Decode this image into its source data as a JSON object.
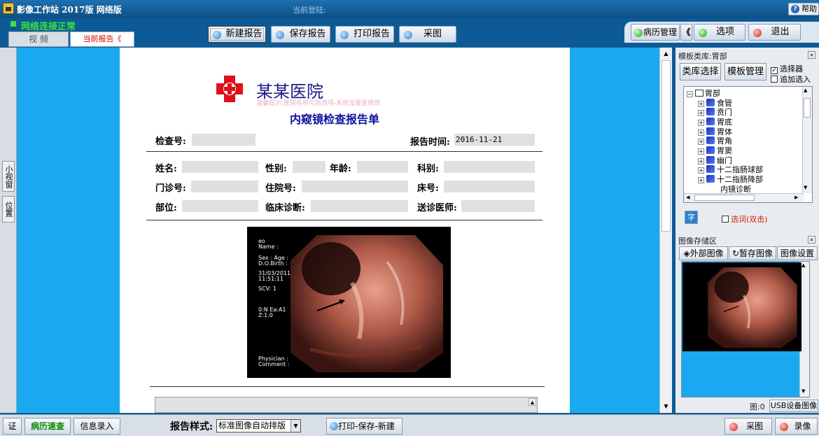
{
  "titlebar": {
    "app_title": "影像工作站 2017版 网络版",
    "login_label": "当前登陆:",
    "help": "帮助"
  },
  "status": {
    "network": "网络连接正常"
  },
  "tabs": {
    "video": "视 频",
    "current_report": "当前报告《"
  },
  "toolbar": {
    "new_report": "新建报告",
    "save_report": "保存报告",
    "print_report": "打印报告",
    "capture": "采图"
  },
  "top_right": {
    "records": "病历管理",
    "collapse": "《",
    "options": "选项",
    "exit": "退出"
  },
  "left_strip": {
    "small_window": "小视窗",
    "position": "位置"
  },
  "report": {
    "hospital_name": "某某医院",
    "hint": "温馨提示:医院名称可到选项-系统设置里修改",
    "title": "内窥镜检查报告单",
    "fields": {
      "exam_no": "检查号:",
      "report_time_label": "报告时间:",
      "report_time_value": "2016-11-21",
      "name": "姓名:",
      "gender": "性别:",
      "age": "年龄:",
      "department": "科别:",
      "outpatient_no": "门诊号:",
      "inpatient_no": "住院号:",
      "bed_no": "床号:",
      "site": "部位:",
      "clinical_diag": "临床诊断:",
      "referring_doctor": "送诊医师:"
    },
    "image_overlay": {
      "line1": "eo",
      "line2": "Name :",
      "line3": "Sex :  Age :",
      "line4": "D.O.Birth :",
      "line5": "31/03/2011",
      "line6": "11:51:11",
      "line7": "SCV: 1",
      "line8": "0:N  Ea:A1",
      "line9": "Z:1.0",
      "line10": "Physician :",
      "line11": "Comment :"
    }
  },
  "template_panel": {
    "title": "模板类库:胃部",
    "library_btn": "类库选择",
    "manage_btn": "模板管理",
    "selector": "选择器",
    "append": "追加选入",
    "tree_root": "胃部",
    "tree_items": [
      "食管",
      "贲门",
      "胃底",
      "胃体",
      "胃角",
      "胃窦",
      "幽门",
      "十二指肠球部",
      "十二指肠降部"
    ],
    "tree_last": "内镜诊断",
    "font_btn": "字",
    "select_word": "选词(双击)"
  },
  "image_panel": {
    "title": "图像存储区",
    "external": "外部图像",
    "temp": "暂存图像",
    "settings": "图像设置",
    "count": "图:0",
    "usb": "USB设备图像"
  },
  "bottom": {
    "cert": "证",
    "quick_records": "病历速查",
    "info_entry": "信息录入",
    "style_label": "报告样式:",
    "style_value": "标准图像自动排版",
    "print_save_new": "打印-保存-新建",
    "capture": "采图",
    "record": "录像"
  },
  "colors": {
    "accent_blue": "#1aa9f0",
    "title_blue": "#0b4f86",
    "status_green": "#39e23b"
  }
}
